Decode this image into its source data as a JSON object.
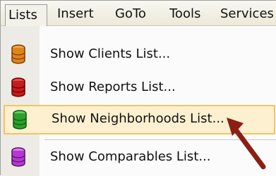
{
  "menubar": {
    "items": [
      {
        "label": "Lists",
        "accesskey": "L"
      },
      {
        "label": "Insert",
        "accesskey": "I"
      },
      {
        "label": "GoTo",
        "accesskey": "G"
      },
      {
        "label": "Tools",
        "accesskey": "T"
      },
      {
        "label": "Services",
        "accesskey": "S"
      }
    ]
  },
  "dropdown": {
    "items": [
      {
        "label": "Show Clients List...",
        "icon": "database-icon",
        "color": "#e0841a"
      },
      {
        "label": "Show Reports List...",
        "icon": "database-icon",
        "color": "#c41b1b"
      },
      {
        "label": "Show Neighborhoods List...",
        "icon": "database-icon",
        "color": "#2e9e2e",
        "highlighted": true
      },
      {
        "label": "Show Comparables List...",
        "icon": "database-icon",
        "color": "#b23ad1"
      }
    ]
  },
  "colors": {
    "highlight_bg": "#fdf0d0",
    "highlight_border": "#f3c461",
    "arrow": "#8b1f15"
  }
}
